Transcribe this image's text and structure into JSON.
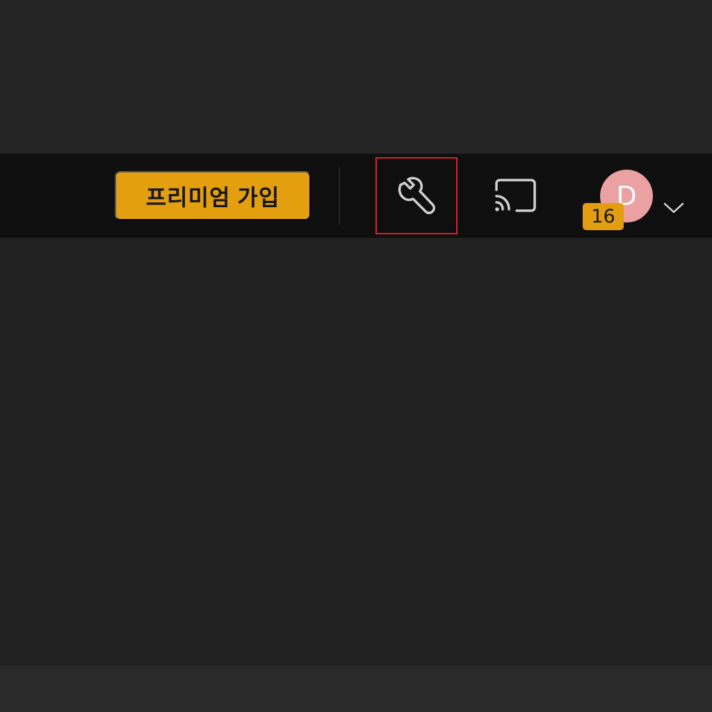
{
  "toolbar": {
    "premium_label": "프리미엄 가입",
    "tools_icon": "wrench-icon",
    "cast_icon": "cast-icon",
    "account": {
      "avatar_letter": "D",
      "badge_count": "16",
      "chevron_icon": "chevron-down-icon"
    }
  },
  "colors": {
    "accent": "#e39f0d",
    "avatar": "#eba0a2",
    "highlight_border": "#e21f1f",
    "toolbar_bg": "#0f0f0f",
    "page_bg": "#232323"
  }
}
